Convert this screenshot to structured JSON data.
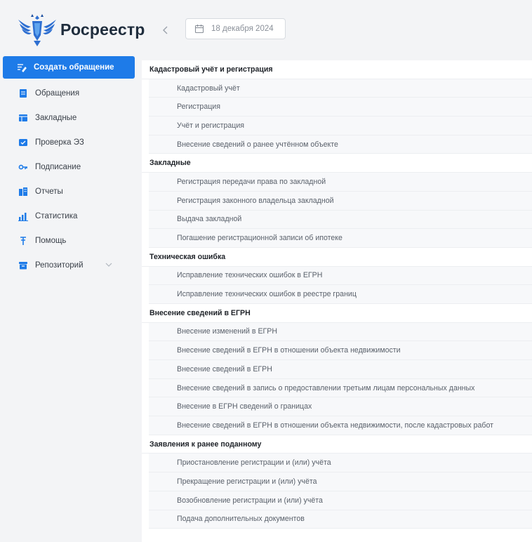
{
  "header": {
    "logo_text": "Росреестр",
    "prev_icon": "chevron-left-icon",
    "date": "18 декабря 2024",
    "date_icon": "calendar-icon"
  },
  "colors": {
    "accent": "#1e7be8",
    "background": "#f3f4f6",
    "panel": "#ffffff",
    "sub_row": "#f7f8fa"
  },
  "sidebar": {
    "items": [
      {
        "label": "Создать обращение",
        "icon": "edit-list-icon",
        "active": true
      },
      {
        "label": "Обращения",
        "icon": "document-icon"
      },
      {
        "label": "Закладные",
        "icon": "table-icon"
      },
      {
        "label": "Проверка ЭЗ",
        "icon": "check-card-icon"
      },
      {
        "label": "Подписание",
        "icon": "key-icon"
      },
      {
        "label": "Отчеты",
        "icon": "building-icon"
      },
      {
        "label": "Статистика",
        "icon": "bar-chart-icon"
      },
      {
        "label": "Помощь",
        "icon": "help-pin-icon"
      },
      {
        "label": "Репозиторий",
        "icon": "archive-icon",
        "expandable": true
      }
    ]
  },
  "main": {
    "rows": [
      {
        "type": "cat",
        "label": "Кадастровый учёт и регистрация"
      },
      {
        "type": "sub",
        "label": "Кадастровый учёт"
      },
      {
        "type": "sub",
        "label": "Регистрация"
      },
      {
        "type": "sub",
        "label": "Учёт и регистрация"
      },
      {
        "type": "sub",
        "label": "Внесение сведений о ранее учтённом объекте"
      },
      {
        "type": "cat",
        "label": "Закладные"
      },
      {
        "type": "sub",
        "label": "Регистрация передачи права по закладной"
      },
      {
        "type": "sub",
        "label": "Регистрация законного владельца закладной"
      },
      {
        "type": "sub",
        "label": "Выдача закладной"
      },
      {
        "type": "sub",
        "label": "Погашение регистрационной записи об ипотеке"
      },
      {
        "type": "cat",
        "label": "Техническая ошибка"
      },
      {
        "type": "sub",
        "label": "Исправление технических ошибок в ЕГРН"
      },
      {
        "type": "sub",
        "label": "Исправление технических ошибок в реестре границ"
      },
      {
        "type": "cat",
        "label": "Внесение сведений в ЕГРН"
      },
      {
        "type": "sub",
        "label": "Внесение изменений в ЕГРН"
      },
      {
        "type": "sub",
        "label": "Внесение сведений в ЕГРН в отношении объекта недвижимости"
      },
      {
        "type": "sub",
        "label": "Внесение сведений в ЕГРН"
      },
      {
        "type": "sub",
        "label": "Внесение сведений в запись о предоставлении третьим лицам персональных данных"
      },
      {
        "type": "sub",
        "label": "Внесение в ЕГРН сведений о границах"
      },
      {
        "type": "sub",
        "label": "Внесение сведений в ЕГРН в отношении объекта недвижимости, после кадастровых работ"
      },
      {
        "type": "cat",
        "label": "Заявления к ранее поданному"
      },
      {
        "type": "sub",
        "label": "Приостановление регистрации и (или) учёта"
      },
      {
        "type": "sub",
        "label": "Прекращение регистрации и (или) учёта"
      },
      {
        "type": "sub",
        "label": "Возобновление регистрации и (или) учёта"
      },
      {
        "type": "sub",
        "label": "Подача дополнительных документов"
      }
    ]
  }
}
